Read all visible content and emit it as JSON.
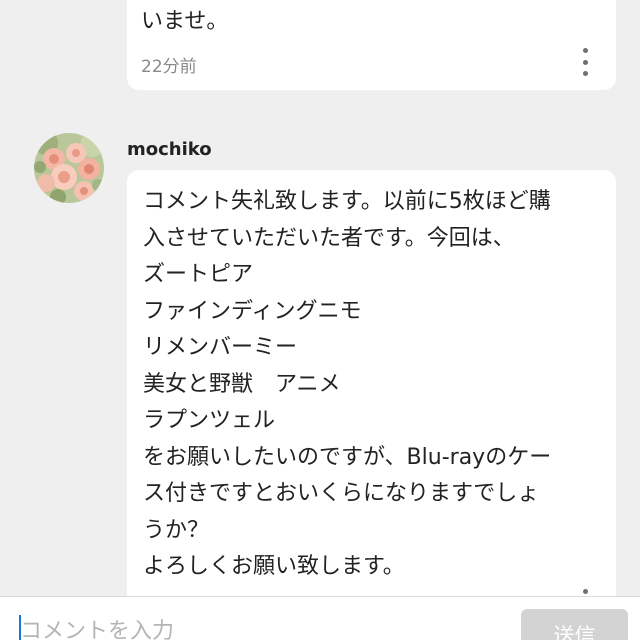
{
  "previous_comment": {
    "text_tail": "いませ。",
    "time": "22分前",
    "menu_icon": "more-vertical-icon"
  },
  "comment": {
    "username": "mochiko",
    "avatar": "flower-bouquet-avatar",
    "lines": [
      "コメント失礼致します。以前に5枚ほど購",
      "入させていただいた者です。今回は、",
      "ズートピア",
      "ファインディングニモ",
      "リメンバーミー",
      "美女と野獣　アニメ",
      "ラプンツェル",
      "をお願いしたいのですが、Blu-rayのケー",
      "ス付きですとおいくらになりますでしょ",
      "うか？",
      "よろしくお願い致します。"
    ],
    "menu_icon": "more-vertical-icon"
  },
  "composer": {
    "placeholder": "コメントを入力",
    "send_label": "送信"
  },
  "colors": {
    "background": "#efefef",
    "card": "#ffffff",
    "caret": "#1976d2",
    "send_button": "#d3d3d3"
  }
}
